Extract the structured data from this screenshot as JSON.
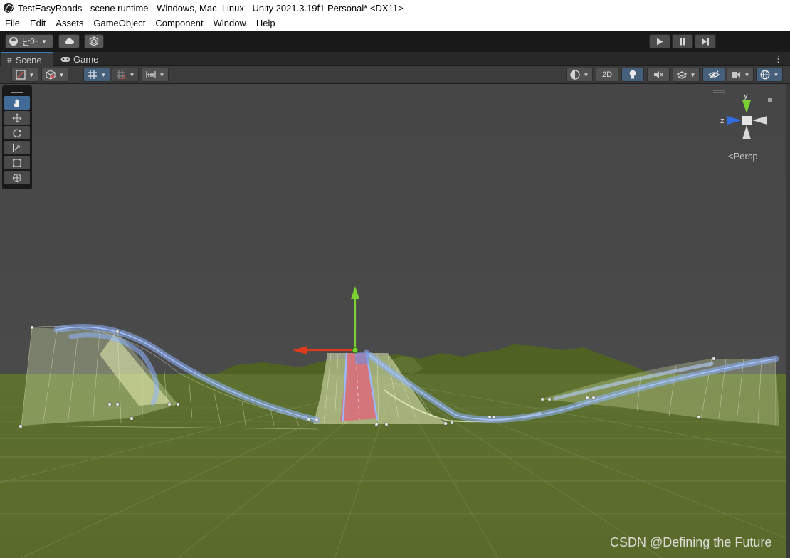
{
  "window": {
    "title": "TestEasyRoads - scene runtime - Windows, Mac, Linux - Unity 2021.3.19f1 Personal* <DX11>"
  },
  "menubar": {
    "items": [
      "File",
      "Edit",
      "Assets",
      "GameObject",
      "Component",
      "Window",
      "Help"
    ]
  },
  "toolbar": {
    "account_label": "난아",
    "play_icon": "play-icon",
    "pause_icon": "pause-icon",
    "step_icon": "step-icon"
  },
  "tabs": {
    "scene": "Scene",
    "game": "Game"
  },
  "scene_toolbar": {
    "twod_label": "2D"
  },
  "gizmo": {
    "y_label": "y",
    "z_label": "z",
    "persp_label": "Persp"
  },
  "watermark": "CSDN @Defining the Future",
  "colors": {
    "accent": "#3a79bb",
    "ground": "#5a6d2a",
    "sky": "#474747",
    "road_spline": "#8fb4ff",
    "road_surface": "#d8707c",
    "gizmo_x": "#e03a1e",
    "gizmo_y": "#7bd134",
    "gizmo_z": "#2f6de0"
  }
}
